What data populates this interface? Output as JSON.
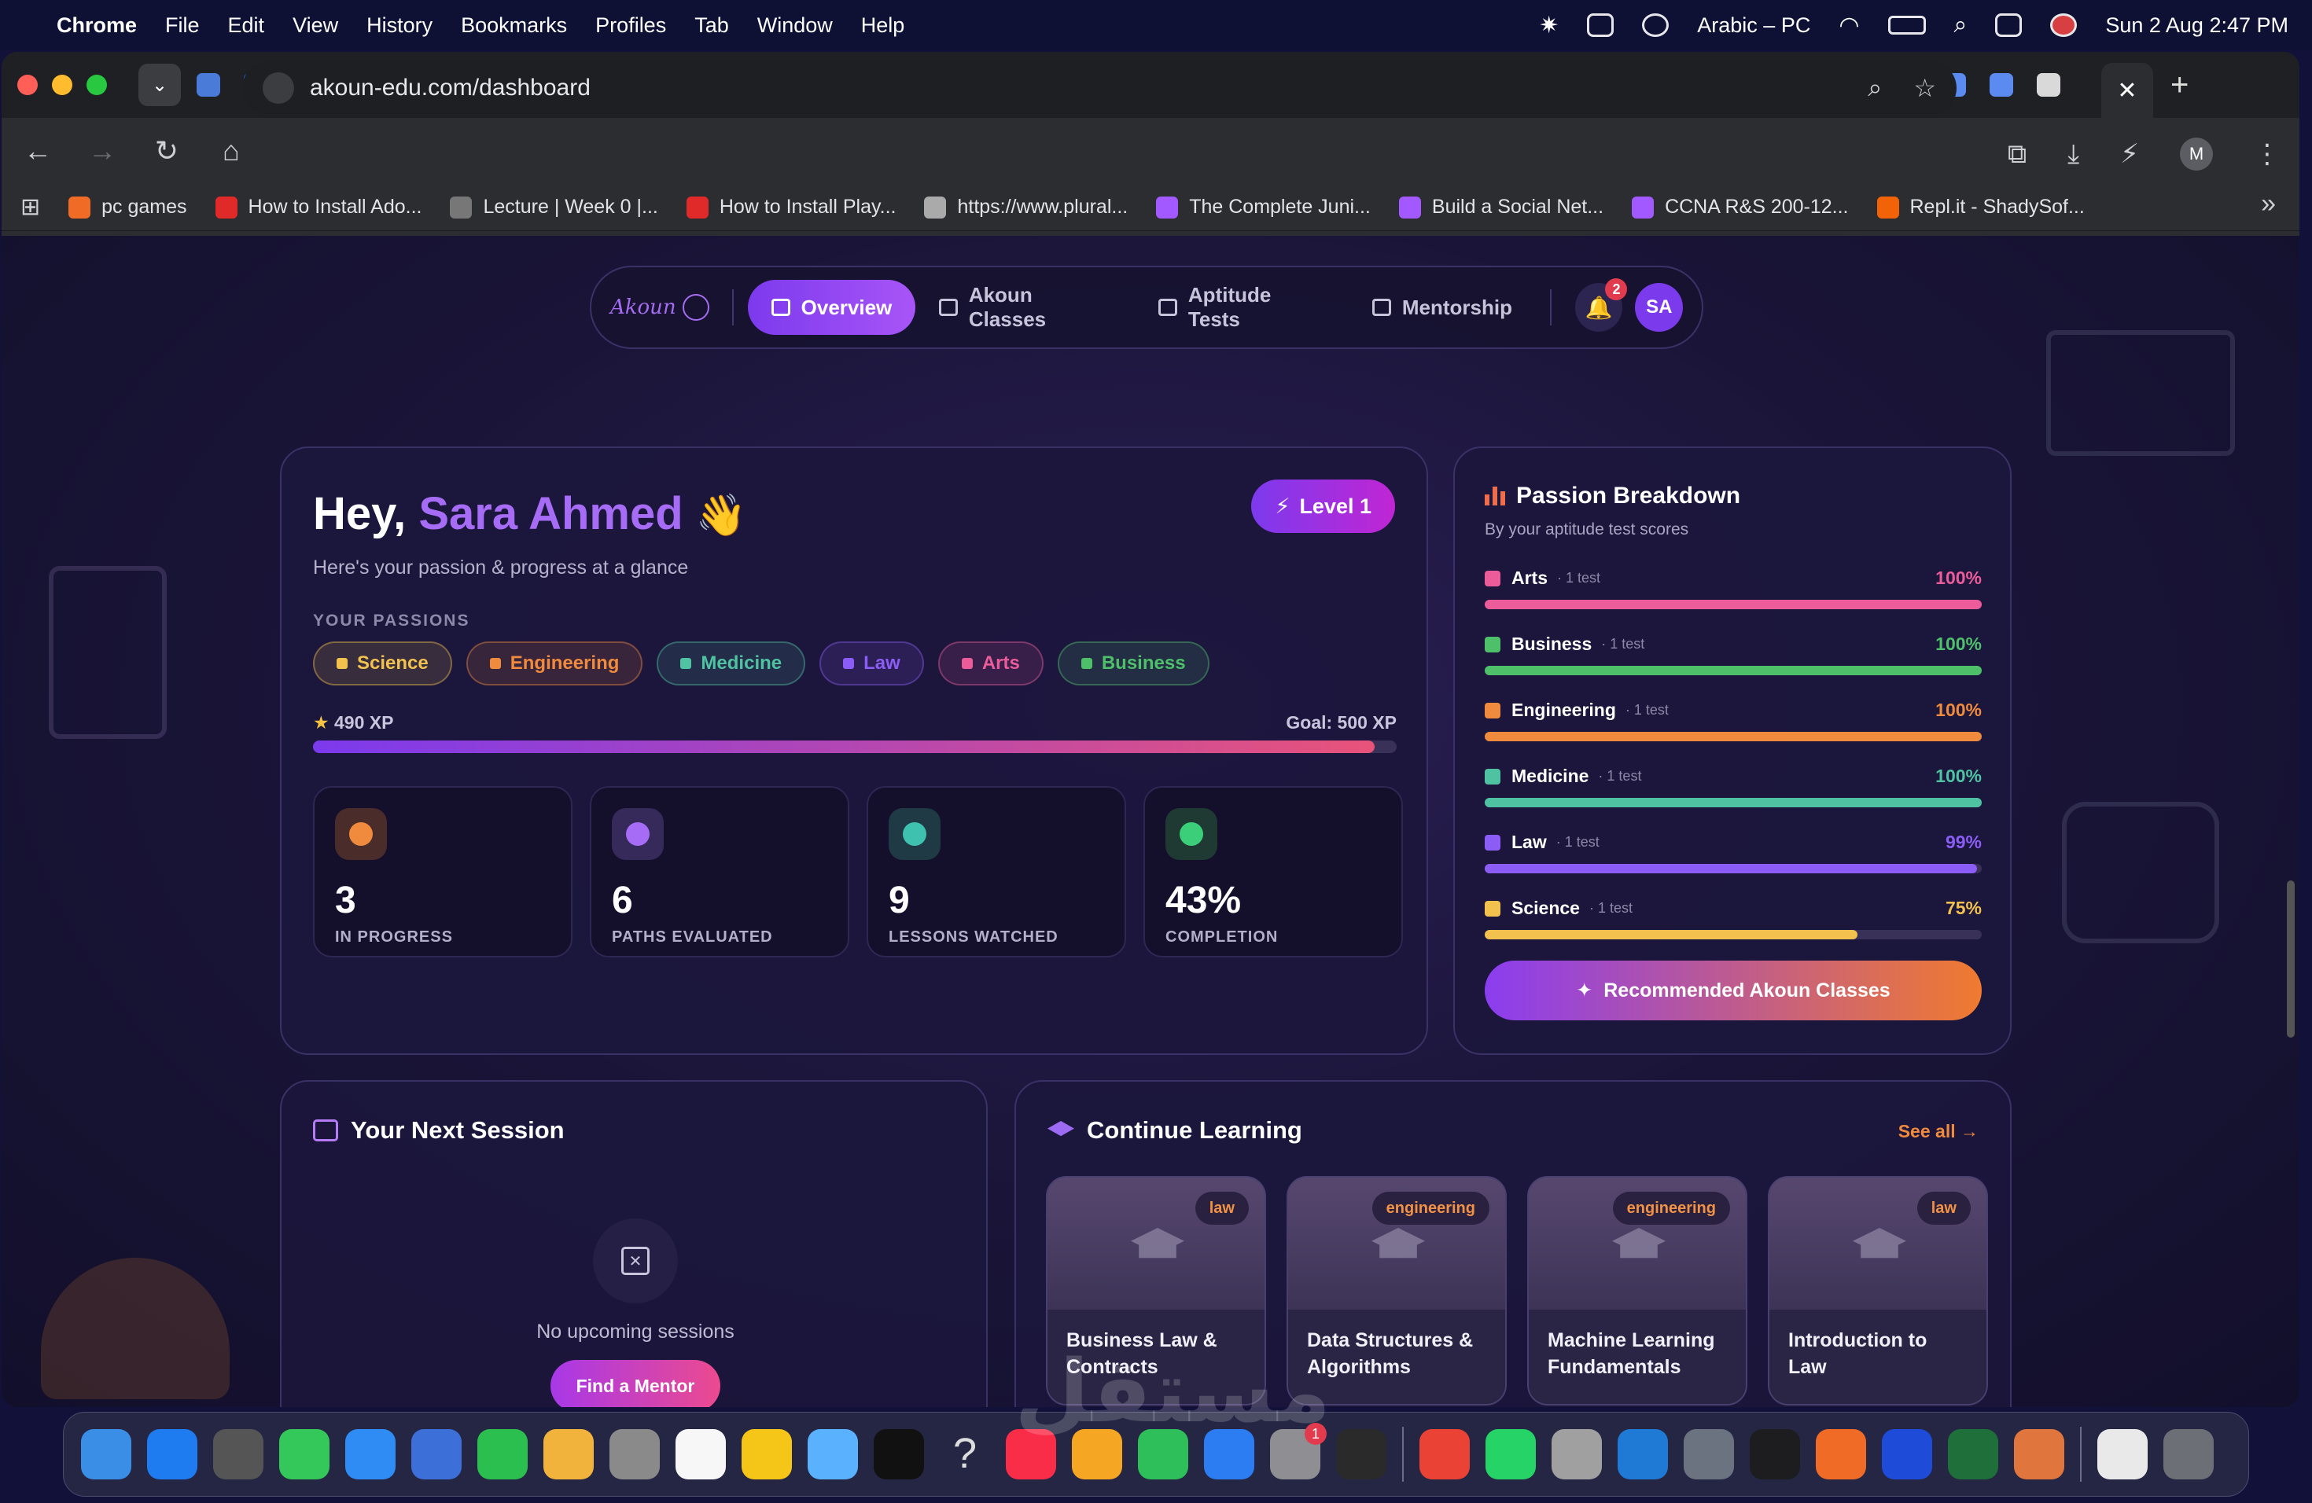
{
  "menubar": {
    "app": "Chrome",
    "items": [
      "File",
      "Edit",
      "View",
      "History",
      "Bookmarks",
      "Profiles",
      "Tab",
      "Window",
      "Help"
    ],
    "input_source": "Arabic – PC",
    "datetime": "Sun 2 Aug  2:47 PM"
  },
  "browser": {
    "url": "akoun-edu.com/dashboard",
    "profile_initial": "M",
    "bookmarks": [
      {
        "label": "pc games",
        "color": "#f06b26"
      },
      {
        "label": "How to Install Ado...",
        "color": "#e02929"
      },
      {
        "label": "Lecture | Week 0 |...",
        "color": "#777777"
      },
      {
        "label": "How to Install Play...",
        "color": "#e02929"
      },
      {
        "label": "https://www.plural...",
        "color": "#aaaaaa"
      },
      {
        "label": "The Complete Juni...",
        "color": "#a259ff"
      },
      {
        "label": "Build a Social Net...",
        "color": "#a259ff"
      },
      {
        "label": "CCNA R&S 200-12...",
        "color": "#a259ff"
      },
      {
        "label": "Repl.it - ShadySof...",
        "color": "#f26207"
      }
    ]
  },
  "nav": {
    "logo": "Akoun",
    "tabs": [
      {
        "label": "Overview",
        "active": true
      },
      {
        "label": "Akoun Classes",
        "active": false
      },
      {
        "label": "Aptitude Tests",
        "active": false
      },
      {
        "label": "Mentorship",
        "active": false
      }
    ],
    "notifications": "2",
    "user_initials": "SA"
  },
  "hero": {
    "greeting": "Hey,",
    "name": "Sara Ahmed",
    "wave": "👋",
    "subtitle": "Here's your passion & progress at a glance",
    "level": "Level 1",
    "passions_label": "YOUR PASSIONS",
    "passions": [
      {
        "label": "Science",
        "color": "#f2c14e"
      },
      {
        "label": "Engineering",
        "color": "#f08a3c"
      },
      {
        "label": "Medicine",
        "color": "#4fc3a1"
      },
      {
        "label": "Law",
        "color": "#8b5cf6"
      },
      {
        "label": "Arts",
        "color": "#ec5c9a"
      },
      {
        "label": "Business",
        "color": "#4ec06a"
      }
    ],
    "xp": "490 XP",
    "goal": "Goal: 500 XP",
    "xp_progress": 0.98,
    "stats": [
      {
        "value": "3",
        "label": "IN PROGRESS",
        "color": "#f08a3c",
        "bg": "#4a2c2a"
      },
      {
        "value": "6",
        "label": "PATHS EVALUATED",
        "color": "#a76cf5",
        "bg": "#352a5a"
      },
      {
        "value": "9",
        "label": "LESSONS WATCHED",
        "color": "#3fc1b0",
        "bg": "#1f3a45"
      },
      {
        "value": "43%",
        "label": "COMPLETION",
        "color": "#3ccf7a",
        "bg": "#1f3a33"
      }
    ]
  },
  "passion_breakdown": {
    "title": "Passion Breakdown",
    "subtitle": "By your aptitude test scores",
    "rows": [
      {
        "name": "Arts",
        "tests": "· 1 test",
        "pct": "100%",
        "value": 1.0,
        "color": "#ec5c9a"
      },
      {
        "name": "Business",
        "tests": "· 1 test",
        "pct": "100%",
        "value": 1.0,
        "color": "#4ec06a"
      },
      {
        "name": "Engineering",
        "tests": "· 1 test",
        "pct": "100%",
        "value": 1.0,
        "color": "#f08a3c"
      },
      {
        "name": "Medicine",
        "tests": "· 1 test",
        "pct": "100%",
        "value": 1.0,
        "color": "#4fc3a1"
      },
      {
        "name": "Law",
        "tests": "· 1 test",
        "pct": "99%",
        "value": 0.99,
        "color": "#8b5cf6"
      },
      {
        "name": "Science",
        "tests": "· 1 test",
        "pct": "75%",
        "value": 0.75,
        "color": "#f2c14e"
      }
    ],
    "button": "Recommended Akoun Classes"
  },
  "session": {
    "title": "Your Next Session",
    "empty": "No upcoming sessions",
    "button": "Find a Mentor"
  },
  "learning": {
    "title": "Continue Learning",
    "see_all": "See all →",
    "courses": [
      {
        "tag": "law",
        "title": "Business Law & Contracts"
      },
      {
        "tag": "engineering",
        "title": "Data Structures & Algorithms"
      },
      {
        "tag": "engineering",
        "title": "Machine Learning Fundamentals"
      },
      {
        "tag": "law",
        "title": "Introduction to Law"
      }
    ]
  },
  "watermark": "مستقل",
  "dock_badge": "1"
}
